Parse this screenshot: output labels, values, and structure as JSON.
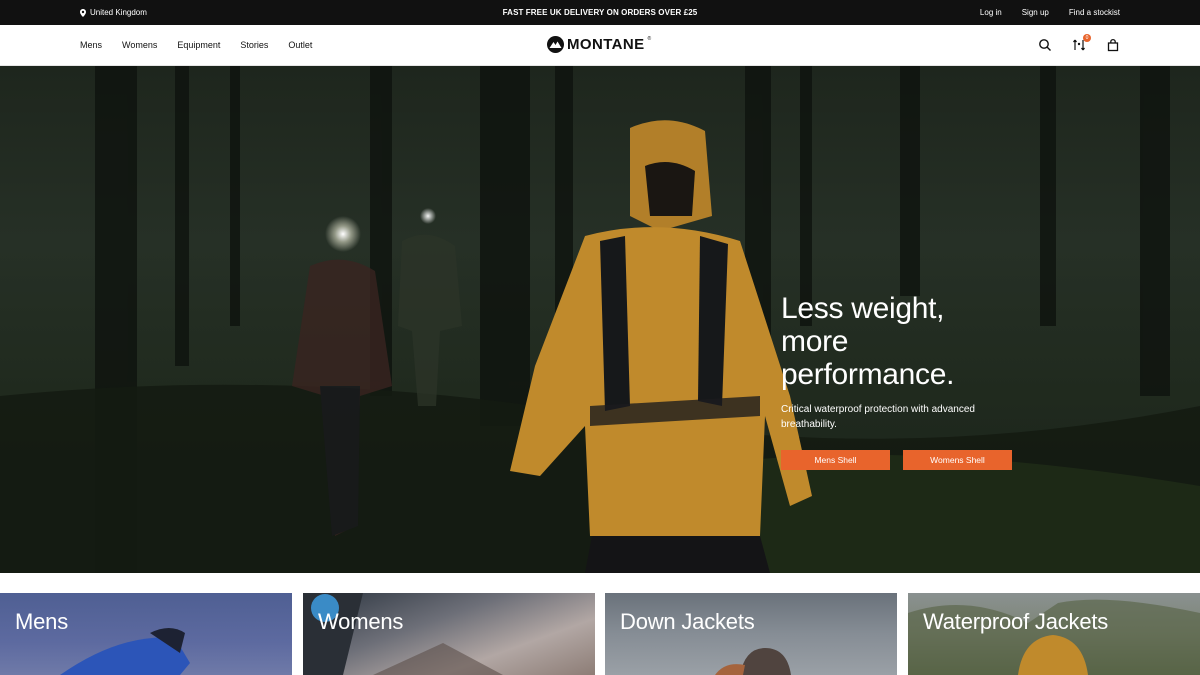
{
  "topbar": {
    "location": "United Kingdom",
    "promo": "FAST FREE UK DELIVERY ON ORDERS OVER £25",
    "links": [
      "Log in",
      "Sign up",
      "Find a stockist"
    ]
  },
  "header": {
    "nav": [
      "Mens",
      "Womens",
      "Equipment",
      "Stories",
      "Outlet"
    ],
    "logo": "MONTANE",
    "logo_mark": "®",
    "icons": [
      "search-icon",
      "compare-icon",
      "bag-icon"
    ],
    "compare_count": "0"
  },
  "hero": {
    "title_lines": [
      "Less weight,",
      "more",
      "performance."
    ],
    "subtitle": "Critical waterproof protection with advanced breathability.",
    "buttons": [
      "Mens Shell",
      "Womens Shell"
    ]
  },
  "categories": [
    "Mens",
    "Womens",
    "Down Jackets",
    "Waterproof Jackets"
  ],
  "colors": {
    "accent": "#e8642c",
    "topbar": "#111111",
    "jacket": "#c08a2c"
  }
}
